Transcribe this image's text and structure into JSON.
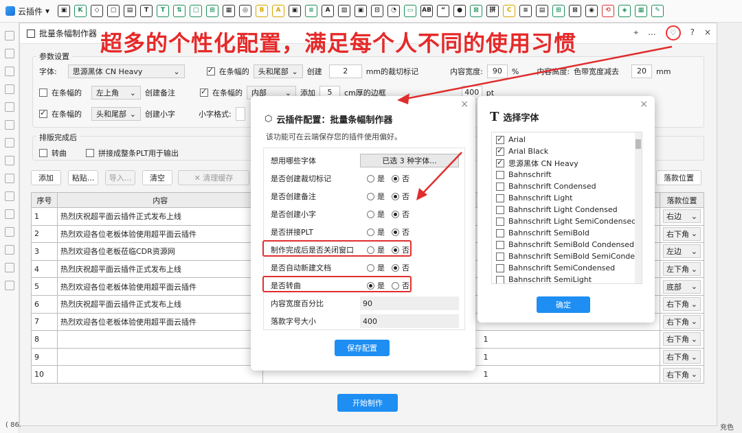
{
  "app": {
    "menu_label": "云插件"
  },
  "window": {
    "title": "批量条幅制作器",
    "ctrl_pin": "⌖",
    "ctrl_more": "...",
    "ctrl_help": "?",
    "ctrl_close": "×",
    "heart": "♡"
  },
  "banner": "超多的个性化配置，满足每个人不同的使用习惯",
  "settings": {
    "group_label": "参数设置",
    "font_label": "字体:",
    "font_value": "思源黑体 CN Heavy",
    "r1_check1": "在条幅的",
    "r1_sel1": "头和尾部",
    "r1_create": "创建",
    "r1_num": "2",
    "r1_after": "mm的裁切标记",
    "width_label": "内容宽度:",
    "width_value": "90",
    "width_unit": "%",
    "height_label": "内容高度:",
    "height_suffix": "色带宽度减去",
    "height_value": "20",
    "height_unit": "mm",
    "r2_check1": "在条幅的",
    "r2_sel1": "左上角",
    "r2_after1": "创建备注",
    "r2_check2": "在条幅的",
    "r2_sel2": "内部",
    "r2_add": "添加",
    "r2_num": "5",
    "r2_after2": "cm厚的边框",
    "r2_sig_value": "400",
    "r2_sig_unit": "pt",
    "r3_check1": "在条幅的",
    "r3_sel1": "头和尾部",
    "r3_after1": "创建小字",
    "r3_small": "小字格式:"
  },
  "finish": {
    "group_label": "排版完成后",
    "opt1": "转曲",
    "opt2": "拼接成整条PLT用于输出"
  },
  "toolbar": {
    "add": "添加",
    "paste": "粘贴...",
    "import": "导入...",
    "clear": "清空",
    "clear_cache": "✕ 清理缓存",
    "sig_pos": "落款位置"
  },
  "table": {
    "headers": [
      "序号",
      "内容",
      "落款位置"
    ],
    "rows": [
      {
        "no": "1",
        "content": "热烈庆祝超平面云插件正式发布上线",
        "pos": "右边"
      },
      {
        "no": "2",
        "content": "热烈欢迎各位老板体验使用超平面云插件",
        "pos": "右下角"
      },
      {
        "no": "3",
        "content": "热烈欢迎各位老板莅临CDR资源网",
        "pos": "左边"
      },
      {
        "no": "4",
        "content": "热烈庆祝超平面云插件正式发布上线",
        "pos": "左下角"
      },
      {
        "no": "5",
        "content": "热烈欢迎各位老板体验使用超平面云插件",
        "pos": "底部"
      },
      {
        "no": "6",
        "content": "热烈庆祝超平面云插件正式发布上线",
        "pos": "右下角"
      },
      {
        "no": "7",
        "content": "热烈欢迎各位老板体验使用超平面云插件",
        "pos": "右下角"
      },
      {
        "no": "8",
        "content": "",
        "pos": "右下角",
        "extra": "1"
      },
      {
        "no": "9",
        "content": "",
        "pos": "右下角",
        "extra": "1"
      },
      {
        "no": "10",
        "content": "",
        "pos": "右下角",
        "extra": "1"
      }
    ]
  },
  "start_button": "开始制作",
  "cloud_dialog": {
    "title": "云插件配置：批量条幅制作器",
    "desc": "该功能可在云端保存您的插件使用偏好。",
    "rows": [
      {
        "label": "想用哪些字体",
        "button": "已选 3 种字体..."
      },
      {
        "label": "是否创建裁切标记",
        "yes": "是",
        "no": "否",
        "value": "no"
      },
      {
        "label": "是否创建备注",
        "yes": "是",
        "no": "否",
        "value": "no"
      },
      {
        "label": "是否创建小字",
        "yes": "是",
        "no": "否",
        "value": "no"
      },
      {
        "label": "是否拼接PLT",
        "yes": "是",
        "no": "否",
        "value": "no"
      },
      {
        "label": "制作完成后是否关闭窗口",
        "yes": "是",
        "no": "否",
        "value": "no"
      },
      {
        "label": "是否自动新建文档",
        "yes": "是",
        "no": "否",
        "value": "no"
      },
      {
        "label": "是否转曲",
        "yes": "是",
        "no": "否",
        "value": "yes"
      },
      {
        "label": "内容宽度百分比",
        "input": "90"
      },
      {
        "label": "落款字号大小",
        "input": "400"
      }
    ],
    "save": "保存配置"
  },
  "font_dialog": {
    "title": "选择字体",
    "fonts": [
      {
        "name": "Arial",
        "checked": true
      },
      {
        "name": "Arial Black",
        "checked": true
      },
      {
        "name": "思源黑体 CN Heavy",
        "checked": true
      },
      {
        "name": "Bahnschrift",
        "checked": false
      },
      {
        "name": "Bahnschrift Condensed",
        "checked": false
      },
      {
        "name": "Bahnschrift Light",
        "checked": false
      },
      {
        "name": "Bahnschrift Light Condensed",
        "checked": false
      },
      {
        "name": "Bahnschrift Light SemiCondensed",
        "checked": false
      },
      {
        "name": "Bahnschrift SemiBold",
        "checked": false
      },
      {
        "name": "Bahnschrift SemiBold Condensed",
        "checked": false
      },
      {
        "name": "Bahnschrift SemiBold SemiConden",
        "checked": false
      },
      {
        "name": "Bahnschrift SemiCondensed",
        "checked": false
      },
      {
        "name": "Bahnschrift SemiLight",
        "checked": false
      }
    ],
    "ok": "确定"
  },
  "status": {
    "left": "( 86.",
    "right": "充色"
  }
}
